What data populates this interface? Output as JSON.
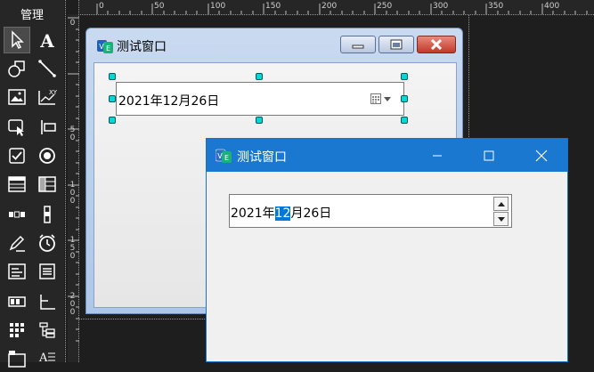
{
  "toolbox": {
    "title": "管理",
    "tools": [
      "pointer-icon",
      "text-icon",
      "shapes-icon",
      "line-icon",
      "picture-icon",
      "chart-xy-icon",
      "button-icon",
      "label-icon",
      "checkbox-icon",
      "radio-icon",
      "table-icon",
      "grid-icon",
      "hscroll-icon",
      "vscroll-icon",
      "pen-icon",
      "clock-icon",
      "listbox-icon",
      "listview-icon",
      "statusbar-icon",
      "tree-icon",
      "grid-view-icon",
      "tree-view-icon",
      "tabs-icon",
      "richtext-icon"
    ],
    "active_tool": "pointer-icon"
  },
  "ruler": {
    "top_labels": [
      "0",
      "50",
      "100",
      "150",
      "200",
      "250",
      "300",
      "350",
      "400"
    ],
    "left_labels": [
      "0",
      "50",
      "100",
      "150",
      "200"
    ]
  },
  "design_window": {
    "title": "测试窗口",
    "logo_text": "VE",
    "picker_value": "2021年12月26日"
  },
  "runtime_window": {
    "title": "测试窗口",
    "logo_text": "VE",
    "picker_before": "2021年",
    "picker_selected": "12",
    "picker_after": "月26日"
  },
  "colors": {
    "accent": "#1a78d0",
    "selection": "#0078d7",
    "handle": "#00d8d8",
    "close_red": "#c0392b"
  }
}
